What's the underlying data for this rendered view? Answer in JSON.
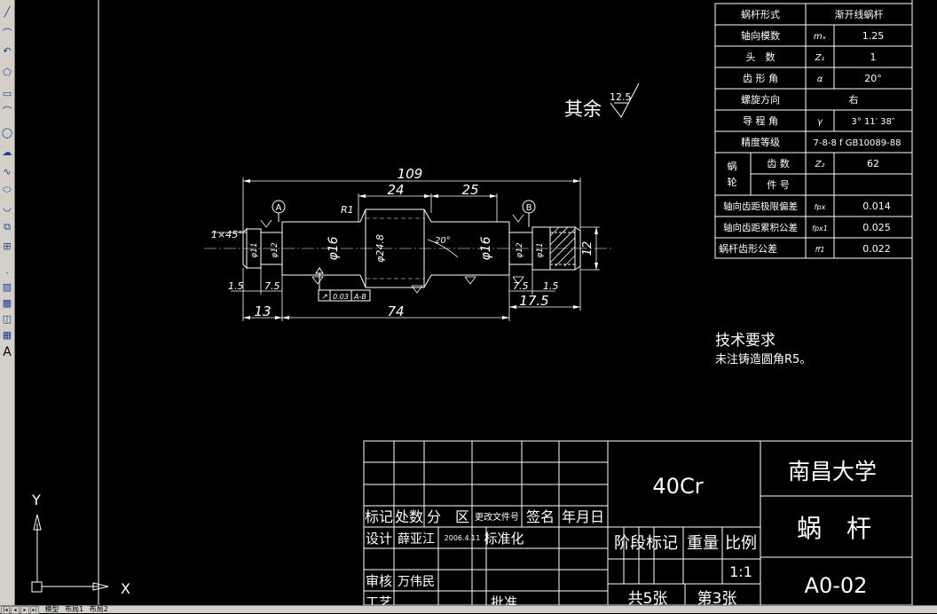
{
  "toolbar": {
    "icons": [
      "line-icon",
      "polyline-icon",
      "arc-icon",
      "polygon-icon",
      "rectangle-icon",
      "arc2-icon",
      "circle-icon",
      "cloud-icon",
      "spline-icon",
      "ellipse-icon",
      "ellipse-arc-icon",
      "insert-block-icon",
      "make-block-icon",
      "point-icon",
      "hatch-icon",
      "gradient-icon",
      "region-icon",
      "table-icon",
      "mtext-icon"
    ],
    "mtext_label": "A"
  },
  "ucs": {
    "x_label": "X",
    "y_label": "Y"
  },
  "param_table": {
    "rows": [
      {
        "label": "蜗杆形式",
        "symbol": "",
        "value": "渐开线蜗杆"
      },
      {
        "label": "轴向模数",
        "symbol": "mₓ",
        "value": "1.25"
      },
      {
        "label": "头　数",
        "symbol": "Z₁",
        "value": "1"
      },
      {
        "label": "齿 形 角",
        "symbol": "α",
        "value": "20°"
      },
      {
        "label": "螺旋方向",
        "symbol": "",
        "value": "右"
      },
      {
        "label": "导 程 角",
        "symbol": "γ",
        "value": "3° 11′ 38″"
      },
      {
        "label": "精度等级",
        "symbol": "",
        "value": "7-8-8 f GB10089-88"
      }
    ],
    "worm_wheel_label": [
      "蜗",
      "轮"
    ],
    "worm_wheel_rows": [
      {
        "label": "齿 数",
        "symbol": "Z₂",
        "value": "62"
      },
      {
        "label": "件 号",
        "symbol": "",
        "value": ""
      }
    ],
    "tolerance_rows": [
      {
        "label": "轴向齿距极限偏差",
        "symbol": "fpx",
        "value": "0.014"
      },
      {
        "label": "轴向齿距累积公差",
        "symbol": "fpx1",
        "value": "0.025"
      },
      {
        "label": "蜗杆齿形公差",
        "symbol": "ff1",
        "value": "0.022"
      }
    ]
  },
  "roughness_note": {
    "text": "其余",
    "value": "12.5"
  },
  "tech_requirements": {
    "title": "技术要求",
    "text": "未注铸造圆角R5。"
  },
  "dimensions": {
    "total_length": "109",
    "len_24": "24",
    "len_25": "25",
    "chamfer": "1×45°",
    "len_1_5_left": "1.5",
    "len_7_5_left": "7.5",
    "len_13": "13",
    "len_74": "74",
    "len_1_5_right": "1.5",
    "len_7_5_right": "7.5",
    "len_17_5": "17.5",
    "dia_16_left": "φ16",
    "dia_16_right": "φ16",
    "dia_24_8": "φ24.8",
    "dia_12_left": "φ12",
    "dia_11_left": "φ11",
    "dia_12_right": "φ12",
    "dia_11_right": "φ11",
    "key_12": "12",
    "radius": "R1",
    "angle": "20°",
    "datum_a": "A",
    "datum_b": "B",
    "tolerance_frame": [
      "↗",
      "0.03",
      "A-B"
    ]
  },
  "title_block": {
    "material": "40Cr",
    "school": "南昌大学",
    "part_name": "蜗　杆",
    "drawing_no": "A0-02",
    "headers": [
      "标记",
      "处数",
      "分　区",
      "更改文件号",
      "签名",
      "年月日"
    ],
    "design_label": "设计",
    "designer": "薛亚江",
    "design_date": "2006.4.11",
    "standardize_label": "标准化",
    "review_label": "审核",
    "reviewer": "万伟民",
    "process_label": "工艺",
    "approve_label": "批准",
    "stage_label": "阶段标记",
    "weight_label": "重量",
    "scale_label": "比例",
    "scale_value": "1:1",
    "sheets_total": "共5张",
    "sheet_current": "第3张"
  },
  "status": {
    "model_tab": "模型",
    "layout_tabs": [
      "布局1",
      "布局2"
    ]
  }
}
